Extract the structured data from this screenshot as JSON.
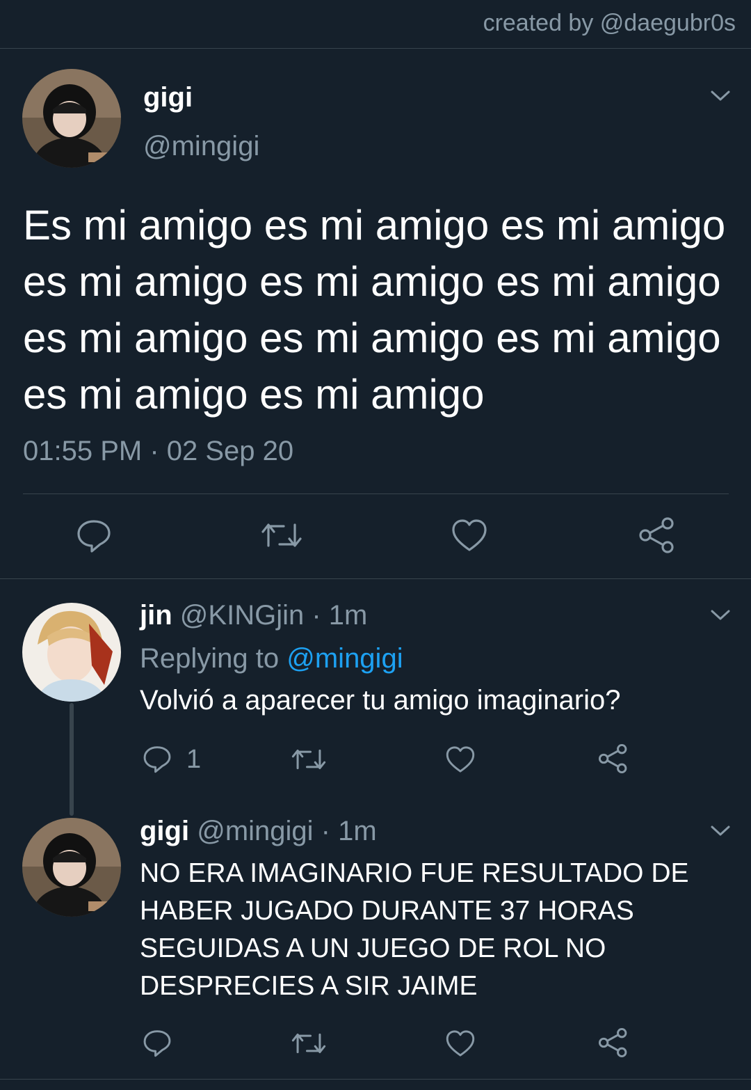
{
  "credit": "created by @daegubr0s",
  "main_tweet": {
    "name": "gigi",
    "handle": "@mingigi",
    "text": "Es mi amigo es mi amigo es mi amigo es mi amigo es mi amigo es mi amigo es mi amigo es mi amigo es mi amigo es mi amigo es mi amigo",
    "timestamp": "01:55 PM · 02 Sep 20",
    "actions": [
      "reply-icon",
      "retweet-icon",
      "like-icon",
      "share-icon"
    ]
  },
  "reply1": {
    "name": "jin",
    "meta": "@KINGjin · 1m",
    "replying_prefix": "Replying to",
    "replying_to": "@mingigi",
    "text": "Volvió a aparecer tu amigo imaginario?",
    "reply_count": "1"
  },
  "reply2": {
    "name": "gigi",
    "meta": "@mingigi · 1m",
    "text": "NO ERA IMAGINARIO FUE RESULTADO DE HABER JUGADO DURANTE 37 HORAS SEGUIDAS A UN JUEGO DE ROL NO DESPRECIES A SIR JAIME"
  },
  "colors": {
    "background": "#15202b",
    "secondary_text": "#8899a6",
    "link": "#1da1f2",
    "divider": "#38444d"
  }
}
